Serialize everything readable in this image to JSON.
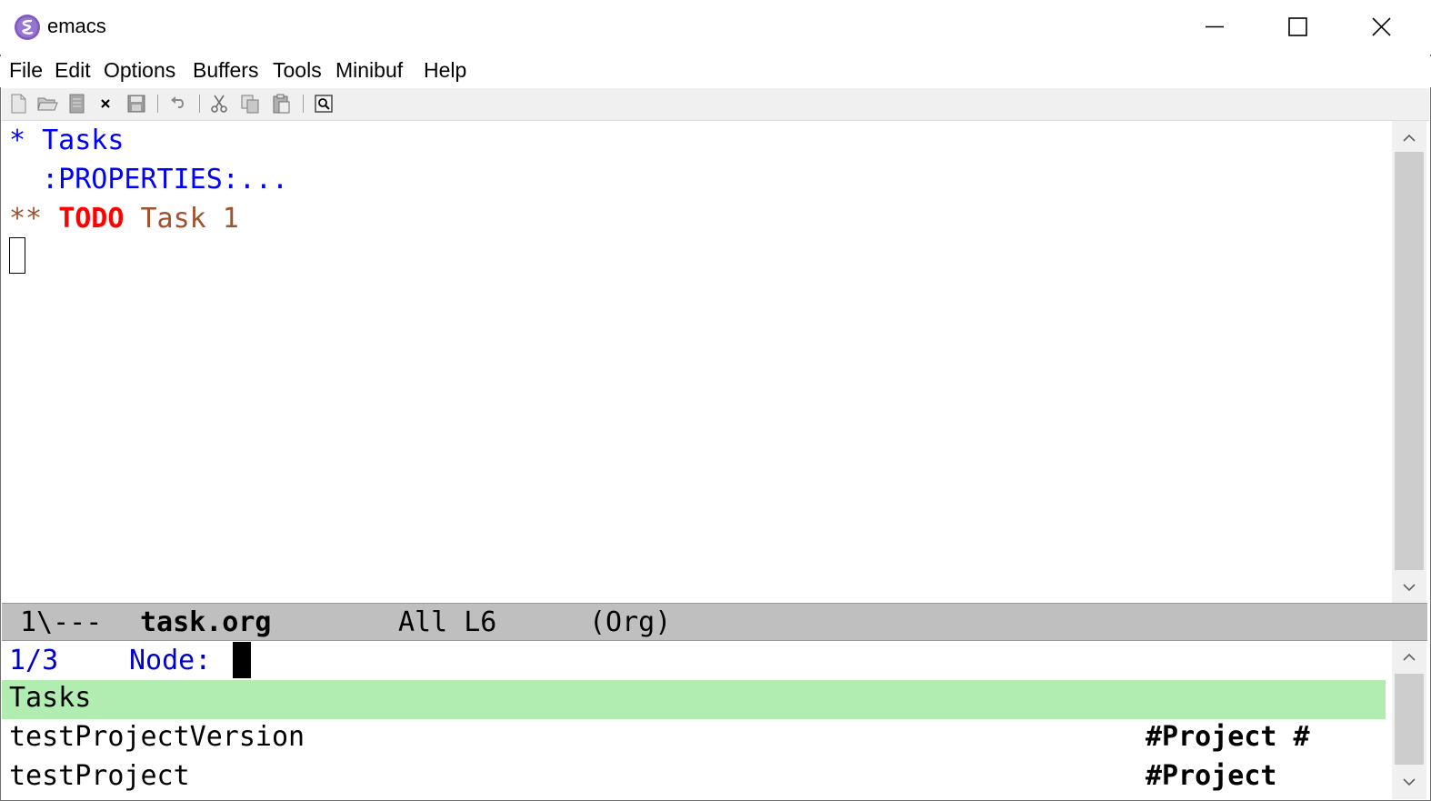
{
  "window": {
    "title": "emacs",
    "controls": [
      "minimize-icon",
      "maximize-icon",
      "close-icon"
    ]
  },
  "menu": {
    "items": [
      "File",
      "Edit",
      "Options",
      "Buffers",
      "Tools",
      "Minibuf",
      "Help"
    ]
  },
  "toolbar": {
    "icons": [
      "new-file-icon",
      "open-folder-icon",
      "open-directory-icon",
      "close-buffer-icon",
      "save-icon",
      "undo-icon",
      "cut-icon",
      "copy-icon",
      "paste-icon",
      "search-icon"
    ]
  },
  "editor": {
    "line1": {
      "stars": "*",
      "text": "Tasks"
    },
    "line2": {
      "text": ":PROPERTIES:..."
    },
    "line3": {
      "stars": "**",
      "keyword": "TODO",
      "text": "Task 1"
    }
  },
  "modeline": {
    "status": "1\\---",
    "buffer_name": "task.org",
    "position": "All L6",
    "mode": "(Org)"
  },
  "minibuffer": {
    "count": "1/3",
    "prompt": "Node:",
    "candidates": [
      {
        "name": "Tasks",
        "tags": "",
        "selected": true
      },
      {
        "name": "testProjectVersion",
        "tags": "#Project #",
        "selected": false
      },
      {
        "name": "testProject",
        "tags": "#Project",
        "selected": false
      }
    ]
  },
  "colors": {
    "heading": "#0000ff",
    "todo": "#ff0000",
    "task": "#a0522d",
    "selection": "#b1edb1",
    "modeline": "#bfbfbf"
  }
}
